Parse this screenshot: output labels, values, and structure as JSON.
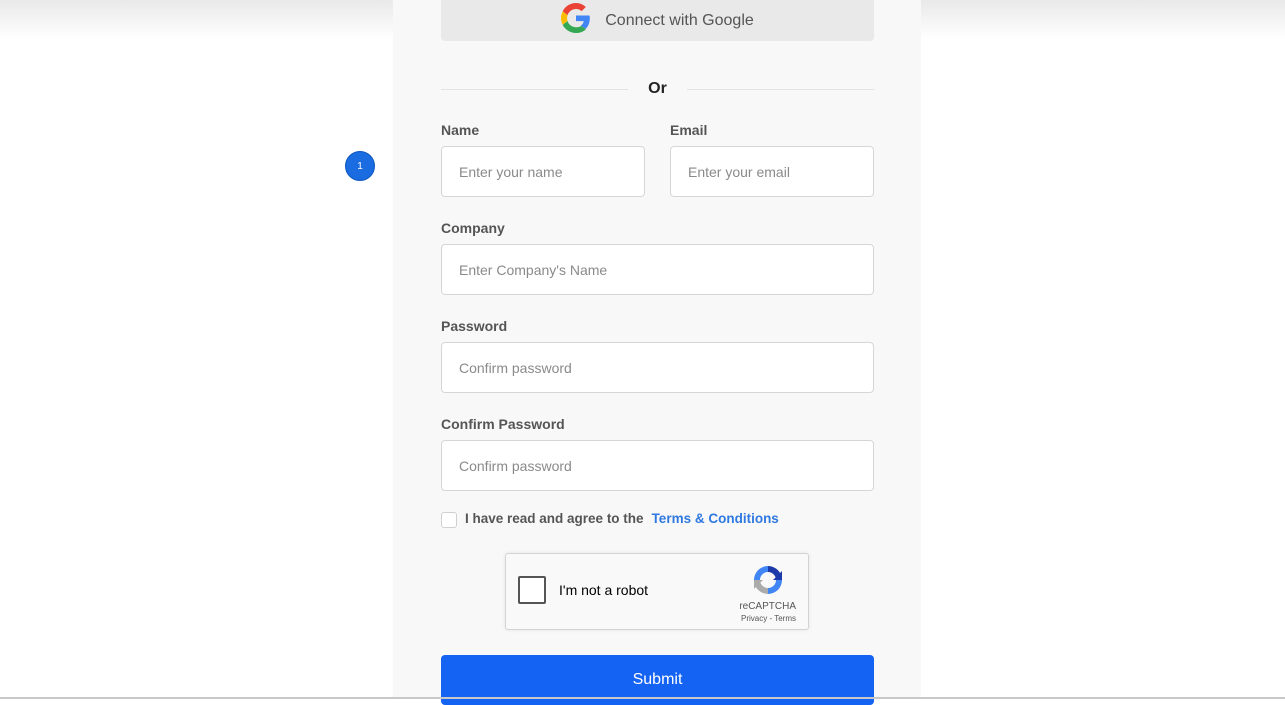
{
  "google_button": {
    "label": "Connect with Google",
    "icon": "google-logo-icon"
  },
  "divider": {
    "label": "Or"
  },
  "step_badge": {
    "number": "1",
    "color": "#1a6ce0"
  },
  "fields": {
    "name": {
      "label": "Name",
      "placeholder": "Enter your name",
      "value": ""
    },
    "email": {
      "label": "Email",
      "placeholder": "Enter your email",
      "value": ""
    },
    "company": {
      "label": "Company",
      "placeholder": "Enter Company's Name",
      "value": ""
    },
    "password": {
      "label": "Password",
      "placeholder": "Confirm password",
      "value": ""
    },
    "confirm_password": {
      "label": "Confirm Password",
      "placeholder": "Confirm password",
      "value": ""
    }
  },
  "agreement": {
    "text": "I have read and agree to the",
    "link": "Terms & Conditions",
    "checked": false
  },
  "recaptcha": {
    "label": "I'm not a robot",
    "brand": "reCAPTCHA",
    "links": "Privacy - Terms",
    "icon": "recaptcha-logo-icon"
  },
  "submit": {
    "label": "Submit",
    "color": "#1463f3"
  },
  "colors": {
    "accent": "#1463f3",
    "link": "#2f79e0",
    "panel": "#f8f8f8"
  }
}
